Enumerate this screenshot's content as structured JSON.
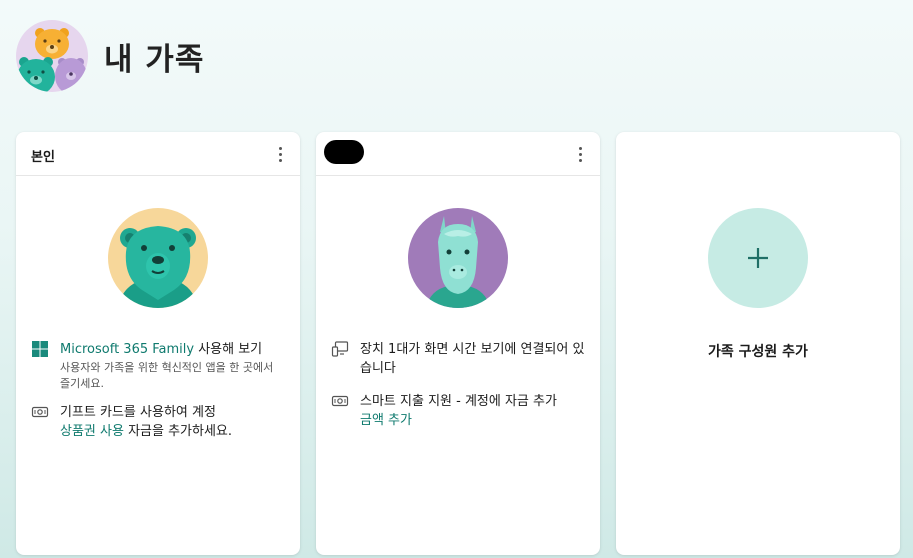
{
  "header": {
    "title": "내 가족"
  },
  "members": [
    {
      "name": "본인",
      "features": [
        {
          "icon": "windows-icon",
          "link": "Microsoft 365 Family",
          "text": " 사용해 보기",
          "sub": "사용자와 가족을 위한 혁신적인 앱을 한 곳에서 즐기세요."
        },
        {
          "icon": "money-icon",
          "text": "기프트 카드를 사용하여 계정 ",
          "link": "상품권 사용",
          "text_after": " 자금을 추가하세요."
        }
      ]
    },
    {
      "name": "",
      "features": [
        {
          "icon": "devices-icon",
          "text": "장치 1대가 화면 시간 보기에 연결되어 있습니다"
        },
        {
          "icon": "money-icon",
          "text": "스마트 지출 지원 - 계정에 자금 추가",
          "link": "금액 추가"
        }
      ]
    }
  ],
  "add_member": {
    "label": "가족 구성원 추가",
    "plus": "+"
  },
  "colors": {
    "accent": "#0f7a6e",
    "add_circle": "#c6ebe4",
    "bear_bg": "#f7d79a",
    "llama_bg": "#a07bb9"
  }
}
